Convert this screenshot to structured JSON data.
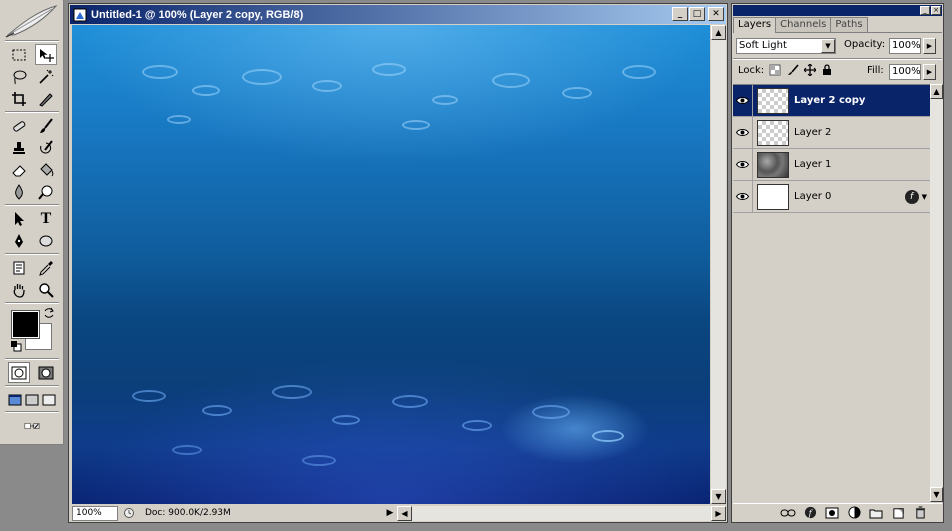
{
  "toolbox": {
    "tools": [
      {
        "name": "marquee-tool-icon"
      },
      {
        "name": "move-tool-icon",
        "selected": true
      },
      {
        "name": "lasso-tool-icon"
      },
      {
        "name": "magic-wand-icon"
      },
      {
        "name": "crop-tool-icon"
      },
      {
        "name": "slice-tool-icon"
      },
      {
        "name": "healing-brush-icon"
      },
      {
        "name": "brush-tool-icon"
      },
      {
        "name": "clone-stamp-icon"
      },
      {
        "name": "history-brush-icon"
      },
      {
        "name": "eraser-tool-icon"
      },
      {
        "name": "paint-bucket-icon"
      },
      {
        "name": "blur-tool-icon"
      },
      {
        "name": "dodge-tool-icon"
      },
      {
        "name": "path-selection-icon"
      },
      {
        "name": "type-tool-icon"
      },
      {
        "name": "pen-tool-icon"
      },
      {
        "name": "ellipse-tool-icon"
      },
      {
        "name": "notes-tool-icon"
      },
      {
        "name": "eyedropper-icon"
      },
      {
        "name": "hand-tool-icon"
      },
      {
        "name": "zoom-tool-icon"
      }
    ],
    "type_glyph": "T",
    "foreground_color": "#000000",
    "background_color": "#ffffff"
  },
  "document": {
    "title": "Untitled-1 @ 100% (Layer 2 copy, RGB/8)",
    "zoom": "100%",
    "doc_info": "Doc: 900.0K/2.93M",
    "window_buttons": {
      "minimize": "_",
      "maximize": "□",
      "close": "✕"
    }
  },
  "layers_panel": {
    "tabs": [
      {
        "label": "Layers",
        "active": true
      },
      {
        "label": "Channels",
        "active": false
      },
      {
        "label": "Paths",
        "active": false
      }
    ],
    "blend_mode": "Soft Light",
    "opacity_label": "Opacity:",
    "opacity_value": "100%",
    "lock_label": "Lock:",
    "fill_label": "Fill:",
    "fill_value": "100%",
    "layers": [
      {
        "name": "Layer 2 copy",
        "selected": true,
        "thumb": "checker",
        "visible": true
      },
      {
        "name": "Layer 2",
        "selected": false,
        "thumb": "checker",
        "visible": true
      },
      {
        "name": "Layer 1",
        "selected": false,
        "thumb": "clouds",
        "visible": true
      },
      {
        "name": "Layer 0",
        "selected": false,
        "thumb": "white",
        "visible": true,
        "has_fx": true
      }
    ],
    "fx_glyph": "f",
    "footer_icons": [
      "link-icon",
      "layer-style-icon",
      "mask-icon",
      "adjustment-layer-icon",
      "new-group-icon",
      "new-layer-icon",
      "trash-icon"
    ]
  },
  "colors": {
    "selection": "#0a246a",
    "chrome": "#d4d0c8",
    "title_gradient_start": "#0a246a",
    "title_gradient_end": "#a6caf0"
  }
}
